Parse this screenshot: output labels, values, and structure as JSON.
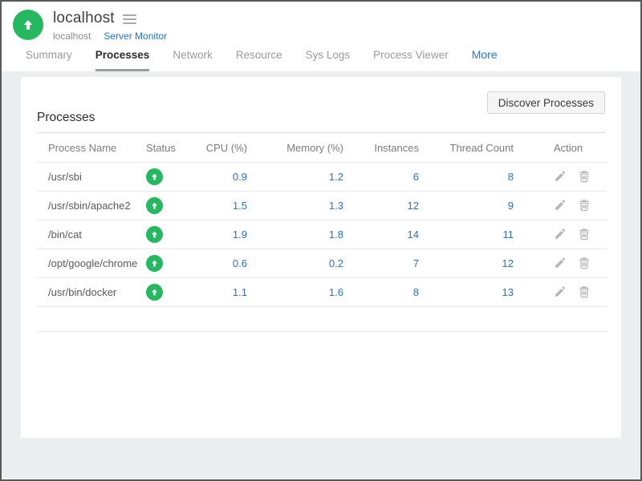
{
  "header": {
    "title": "localhost",
    "subtitle_host": "localhost",
    "monitor_link": "Server Monitor",
    "status_icon": "up-arrow-circle"
  },
  "tabs": [
    {
      "label": "Summary",
      "active": false
    },
    {
      "label": "Processes",
      "active": true
    },
    {
      "label": "Network",
      "active": false
    },
    {
      "label": "Resource",
      "active": false
    },
    {
      "label": "Sys Logs",
      "active": false
    },
    {
      "label": "Process Viewer",
      "active": false
    },
    {
      "label": "More",
      "active": false,
      "accent": true
    }
  ],
  "panel": {
    "discover_button_label": "Discover Processes",
    "section_title": "Processes",
    "table": {
      "columns": [
        "Process Name",
        "Status",
        "CPU (%)",
        "Memory (%)",
        "Instances",
        "Thread Count",
        "Action"
      ],
      "rows": [
        {
          "name": "/usr/sbi",
          "status": "up",
          "cpu": "0.9",
          "memory": "1.2",
          "instances": "6",
          "threads": "8"
        },
        {
          "name": "/usr/sbin/apache2",
          "status": "up",
          "cpu": "1.5",
          "memory": "1.3",
          "instances": "12",
          "threads": "9"
        },
        {
          "name": "/bin/cat",
          "status": "up",
          "cpu": "1.9",
          "memory": "1.8",
          "instances": "14",
          "threads": "11"
        },
        {
          "name": "/opt/google/chrome",
          "status": "up",
          "cpu": "0.6",
          "memory": "0.2",
          "instances": "7",
          "threads": "12"
        },
        {
          "name": "/usr/bin/docker",
          "status": "up",
          "cpu": "1.1",
          "memory": "1.6",
          "instances": "8",
          "threads": "13"
        }
      ],
      "action_icons": [
        "edit",
        "delete"
      ]
    }
  },
  "colors": {
    "status_green": "#26b860",
    "link_blue": "#2274dc",
    "value_blue": "#2b6fd9",
    "page_background": "#ecedee",
    "frame_border": "#58595b"
  }
}
